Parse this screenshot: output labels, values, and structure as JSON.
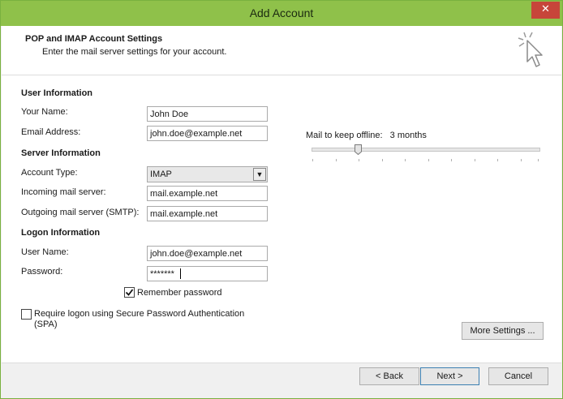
{
  "window": {
    "title": "Add Account",
    "close_glyph": "✕"
  },
  "header": {
    "title": "POP and IMAP Account Settings",
    "subtitle": "Enter the mail server settings for your account.",
    "icon": "cursor-sparkle-icon"
  },
  "user_info": {
    "section": "User Information",
    "name_label": "Your Name:",
    "name_value": "John Doe",
    "email_label": "Email Address:",
    "email_value": "john.doe@example.net"
  },
  "server_info": {
    "section": "Server Information",
    "account_type_label": "Account Type:",
    "account_type_value": "IMAP",
    "incoming_label": "Incoming mail server:",
    "incoming_value": "mail.example.net",
    "outgoing_label": "Outgoing mail server (SMTP):",
    "outgoing_value": "mail.example.net"
  },
  "logon_info": {
    "section": "Logon Information",
    "username_label": "User Name:",
    "username_value": "john.doe@example.net",
    "password_label": "Password:",
    "password_value": "*******",
    "remember_label": "Remember password",
    "remember_checked": true,
    "spa_label": "Require logon using Secure Password Authentication (SPA)",
    "spa_checked": false
  },
  "offline": {
    "label": "Mail to keep offline:",
    "value": "3 months",
    "slider_position": 0.2
  },
  "buttons": {
    "more_settings": "More Settings ...",
    "back": "< Back",
    "next": "Next >",
    "cancel": "Cancel"
  },
  "colors": {
    "titlebar": "#8fc14a",
    "close": "#c7453a",
    "default_button_border": "#3c7fb1"
  }
}
